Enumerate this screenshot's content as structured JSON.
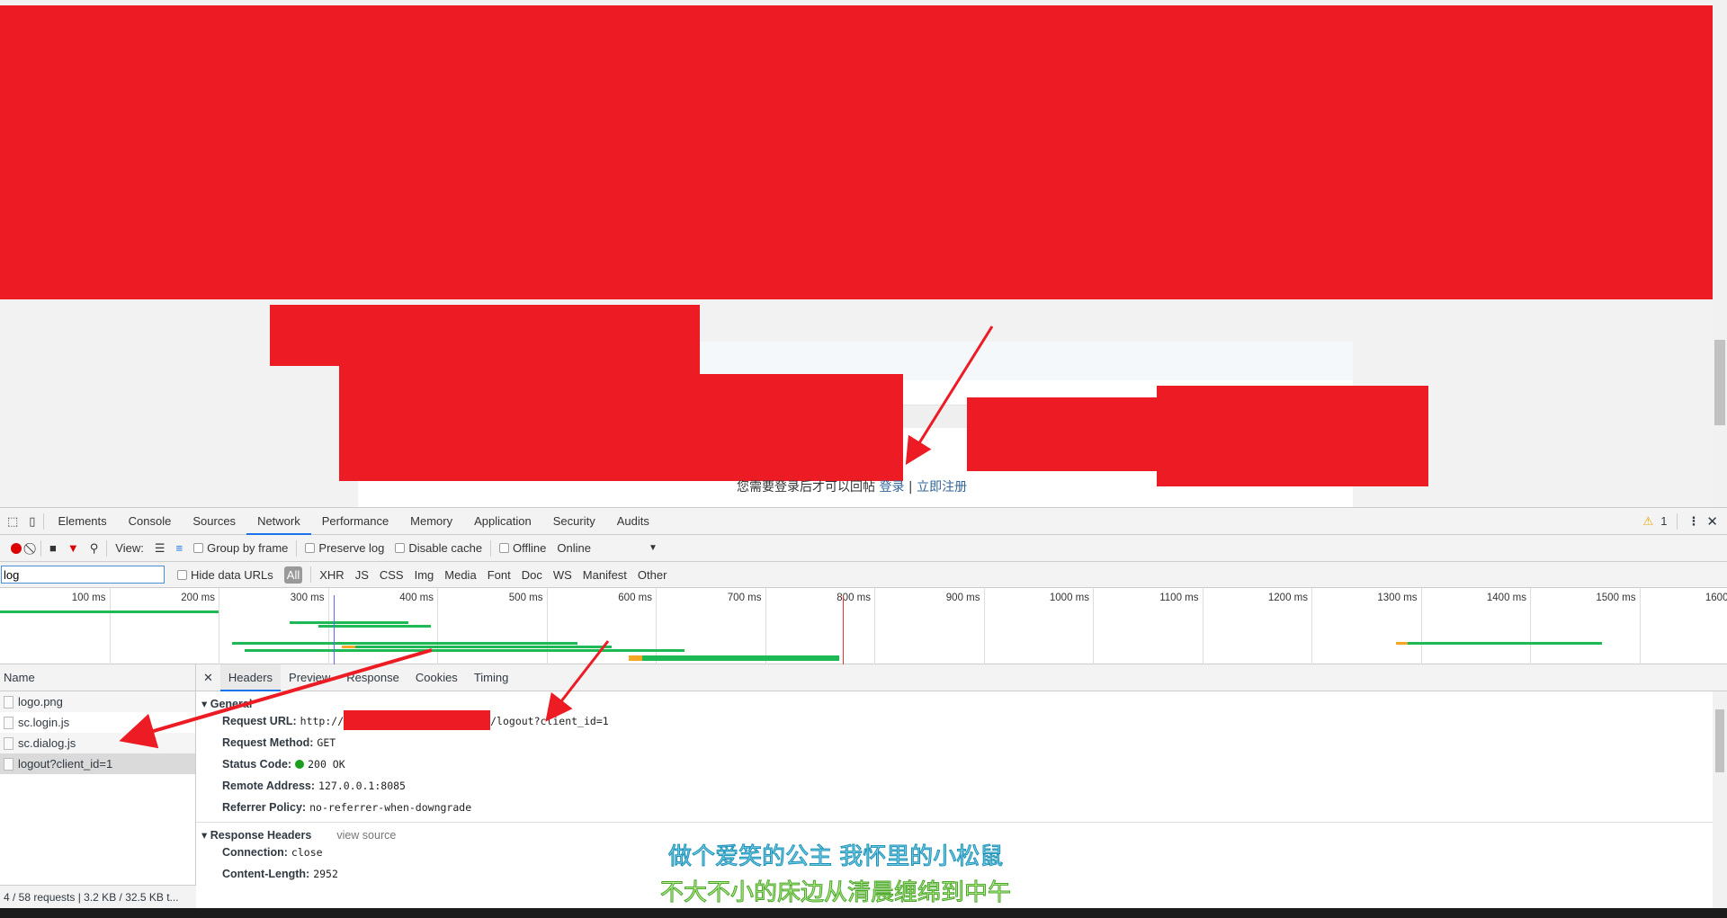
{
  "page": {
    "reply_prompt": "您需要登录后才可以回帖",
    "login_link": "登录",
    "separator": "|",
    "register_link": "立即注册"
  },
  "devtools": {
    "tabs": [
      "Elements",
      "Console",
      "Sources",
      "Network",
      "Performance",
      "Memory",
      "Application",
      "Security",
      "Audits"
    ],
    "active_tab": "Network",
    "warning_count": "1",
    "toolbar": {
      "view_label": "View:",
      "group_by_frame": "Group by frame",
      "preserve_log": "Preserve log",
      "disable_cache": "Disable cache",
      "offline": "Offline",
      "throttle": "Online"
    },
    "filter": {
      "value": "log",
      "hide_data_urls": "Hide data URLs",
      "types": [
        "All",
        "XHR",
        "JS",
        "CSS",
        "Img",
        "Media",
        "Font",
        "Doc",
        "WS",
        "Manifest",
        "Other"
      ],
      "active_type": "All"
    },
    "timeline": {
      "ticks": [
        "100 ms",
        "200 ms",
        "300 ms",
        "400 ms",
        "500 ms",
        "600 ms",
        "700 ms",
        "800 ms",
        "900 ms",
        "1000 ms",
        "1100 ms",
        "1200 ms",
        "1300 ms",
        "1400 ms",
        "1500 ms",
        "1600 ms"
      ],
      "bars_ms": [
        {
          "start": 0,
          "end": 200,
          "color": "#1db954"
        },
        {
          "start": 265,
          "end": 374,
          "color": "#1db954"
        },
        {
          "start": 291,
          "end": 394,
          "color": "#1db954"
        },
        {
          "start": 212,
          "end": 528,
          "color": "#1db954"
        },
        {
          "start": 313,
          "end": 325,
          "color": "#f5a623"
        },
        {
          "start": 325,
          "end": 560,
          "color": "#1db954"
        },
        {
          "start": 224,
          "end": 626,
          "color": "#1db954"
        },
        {
          "start": 575,
          "end": 588,
          "color": "#f5a623"
        },
        {
          "start": 588,
          "end": 768,
          "color": "#1db954"
        },
        {
          "start": 212,
          "end": 270,
          "color": "#1db954"
        },
        {
          "start": 270,
          "end": 313,
          "color": "#1a9ef5"
        },
        {
          "start": 1277,
          "end": 1288,
          "color": "#f5a623"
        },
        {
          "start": 1288,
          "end": 1466,
          "color": "#1db954"
        }
      ],
      "load_event_ms": 771,
      "dom_content_loaded_ms": 305
    },
    "requests": {
      "header": "Name",
      "items": [
        "logo.png",
        "sc.login.js",
        "sc.dialog.js",
        "logout?client_id=1"
      ],
      "selected": "logout?client_id=1",
      "summary": "4 / 58 requests | 3.2 KB / 32.5 KB t..."
    },
    "detail": {
      "tabs": [
        "Headers",
        "Preview",
        "Response",
        "Cookies",
        "Timing"
      ],
      "active": "Headers",
      "general_title": "General",
      "general": [
        {
          "key": "Request URL:",
          "value_prefix": "http://",
          "value_suffix": "/logout?client_id=1"
        },
        {
          "key": "Request Method:",
          "value": "GET"
        },
        {
          "key": "Status Code:",
          "value": "200 OK"
        },
        {
          "key": "Remote Address:",
          "value": "127.0.0.1:8085"
        },
        {
          "key": "Referrer Policy:",
          "value": "no-referrer-when-downgrade"
        }
      ],
      "response_headers_title": "Response Headers",
      "view_source": "view source",
      "response_headers": [
        {
          "key": "Connection:",
          "value": "close"
        },
        {
          "key": "Content-Length:",
          "value": "2952"
        }
      ]
    }
  },
  "overlay": {
    "line1": "做个爱笑的公主 我怀里的小松鼠",
    "line2": "不大不小的床边从清晨缠绵到中午"
  },
  "colors": {
    "redaction": "#ed1c24",
    "accent": "#1a73e8"
  }
}
